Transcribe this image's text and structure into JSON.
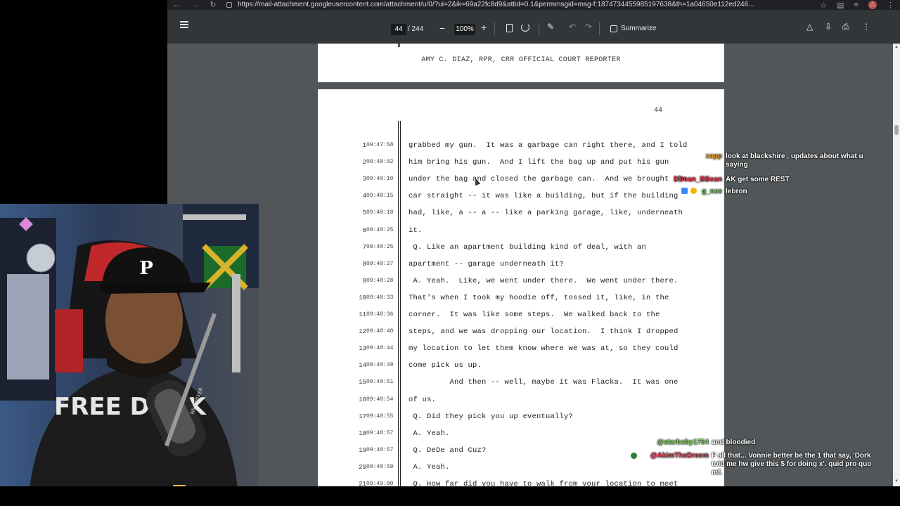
{
  "browser": {
    "url": "https://mail-attachment.googleusercontent.com/attachment/u/0/?ui=2&ik=69a22fc8d9&attid=0.1&permmsgid=msg-f:1874734455985197638&th=1a04650e112ed246...",
    "avatar_letter": "A"
  },
  "toolbar": {
    "page_current": "44",
    "page_total": "/ 244",
    "zoom": "100%",
    "summarize_label": "Summarize"
  },
  "pdf": {
    "footer": "AMY C. DIAZ, RPR, CRR OFFICIAL COURT REPORTER",
    "page_number": "44",
    "lines": [
      {
        "n": "1",
        "t": "09:47:58",
        "text": "grabbed my gun.  It was a garbage can right there, and I told"
      },
      {
        "n": "2",
        "t": "09:48:02",
        "text": "him bring his gun.  And I lift the bag up and put his gun"
      },
      {
        "n": "3",
        "t": "09:48:10",
        "text": "under the bag and closed the garbage can.  And we brought the"
      },
      {
        "n": "4",
        "t": "09:48:15",
        "text": "car straight -- it was like a building, but if the building"
      },
      {
        "n": "5",
        "t": "09:48:18",
        "text": "had, like, a -- a -- like a parking garage, like, underneath"
      },
      {
        "n": "6",
        "t": "09:48:25",
        "text": "it."
      },
      {
        "n": "7",
        "t": "09:48:25",
        "text": " Q. Like an apartment building kind of deal, with an"
      },
      {
        "n": "8",
        "t": "09:48:27",
        "text": "apartment -- garage underneath it?"
      },
      {
        "n": "9",
        "t": "09:48:28",
        "text": " A. Yeah.  Like, we went under there.  We went under there."
      },
      {
        "n": "10",
        "t": "09:48:33",
        "text": "That's when I took my hoodie off, tossed it, like, in the"
      },
      {
        "n": "11",
        "t": "09:48:36",
        "text": "corner.  It was like some steps.  We walked back to the"
      },
      {
        "n": "12",
        "t": "09:48:40",
        "text": "steps, and we was dropping our location.  I think I dropped"
      },
      {
        "n": "13",
        "t": "09:48:44",
        "text": "my location to let them know where we was at, so they could"
      },
      {
        "n": "14",
        "t": "09:48:49",
        "text": "come pick us up."
      },
      {
        "n": "15",
        "t": "09:48:51",
        "text": "         And then -- well, maybe it was Flacka.  It was one"
      },
      {
        "n": "16",
        "t": "09:48:54",
        "text": "of us."
      },
      {
        "n": "17",
        "t": "09:48:55",
        "text": " Q. Did they pick you up eventually?"
      },
      {
        "n": "18",
        "t": "09:48:57",
        "text": " A. Yeah."
      },
      {
        "n": "19",
        "t": "09:48:57",
        "text": " Q. DeDe and Cuz?"
      },
      {
        "n": "20",
        "t": "09:48:59",
        "text": " A. Yeah."
      },
      {
        "n": "21",
        "t": "09:49:00",
        "text": " Q. How far did you have to walk from your location to meet"
      }
    ]
  },
  "chat": {
    "top": [
      {
        "user": "xapp",
        "message": "look at blackshire , updates about what u saying",
        "color": "#e8a33d"
      },
      {
        "user": "DDean_BBean",
        "message": "AK get some REST",
        "color": "#e8364a"
      },
      {
        "user": "g_nee",
        "message": "lebron",
        "color": "#6fcf4f"
      }
    ],
    "bottom": [
      {
        "user": "@starbaby1754",
        "message": "and bloodied",
        "color": "#7ed957"
      },
      {
        "user": "@AkimTheDreem",
        "message": "F all that... Vonnie better be the 1 that say, 'Dork told me hw give this $ for doing x'. quid pro quo mf.",
        "color": "#e8364a"
      }
    ]
  },
  "webcam": {
    "cap_letter": "P",
    "shirt_text": "FREE DURK",
    "mic_label": "N&A MIXER"
  },
  "colors": {
    "pdf_background": "#525659",
    "toolbar": "#323639",
    "urlbar": "#202124"
  }
}
